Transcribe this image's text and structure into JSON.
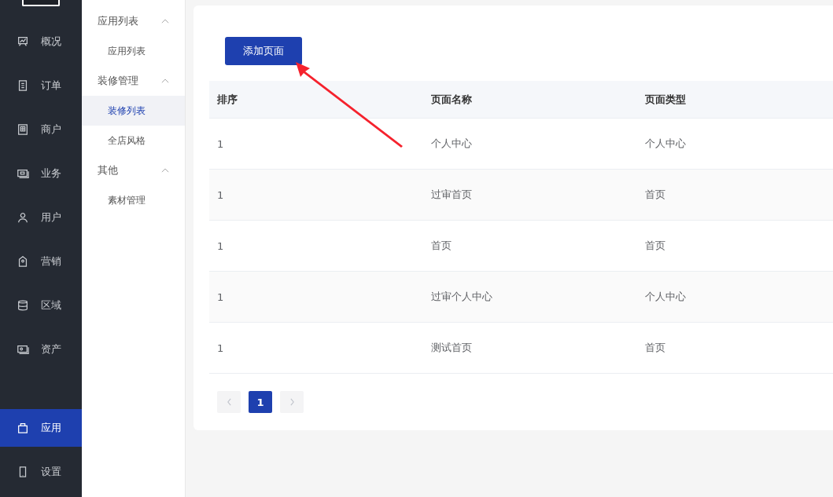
{
  "sidebar": {
    "items": [
      {
        "label": "概况",
        "selected": false
      },
      {
        "label": "订单",
        "selected": false
      },
      {
        "label": "商户",
        "selected": false
      },
      {
        "label": "业务",
        "selected": false
      },
      {
        "label": "用户",
        "selected": false
      },
      {
        "label": "营销",
        "selected": false
      },
      {
        "label": "区域",
        "selected": false
      },
      {
        "label": "资产",
        "selected": false
      }
    ],
    "bottom_items": [
      {
        "label": "应用",
        "selected": true
      },
      {
        "label": "设置",
        "selected": false
      }
    ]
  },
  "submenu": {
    "groups": [
      {
        "label": "应用列表",
        "expanded": true,
        "items": [
          {
            "label": "应用列表",
            "selected": false
          }
        ]
      },
      {
        "label": "装修管理",
        "expanded": true,
        "items": [
          {
            "label": "装修列表",
            "selected": true
          },
          {
            "label": "全店风格",
            "selected": false
          }
        ]
      },
      {
        "label": "其他",
        "expanded": true,
        "items": [
          {
            "label": "素材管理",
            "selected": false
          }
        ]
      }
    ]
  },
  "add_button": "添加页面",
  "table": {
    "columns": [
      "排序",
      "页面名称",
      "页面类型"
    ],
    "rows": [
      [
        "1",
        "个人中心",
        "个人中心"
      ],
      [
        "1",
        "过审首页",
        "首页"
      ],
      [
        "1",
        "首页",
        "首页"
      ],
      [
        "1",
        "过审个人中心",
        "个人中心"
      ],
      [
        "1",
        "测试首页",
        "首页"
      ]
    ]
  },
  "pagination": {
    "pages": [
      {
        "label": "1",
        "selected": true
      }
    ]
  }
}
